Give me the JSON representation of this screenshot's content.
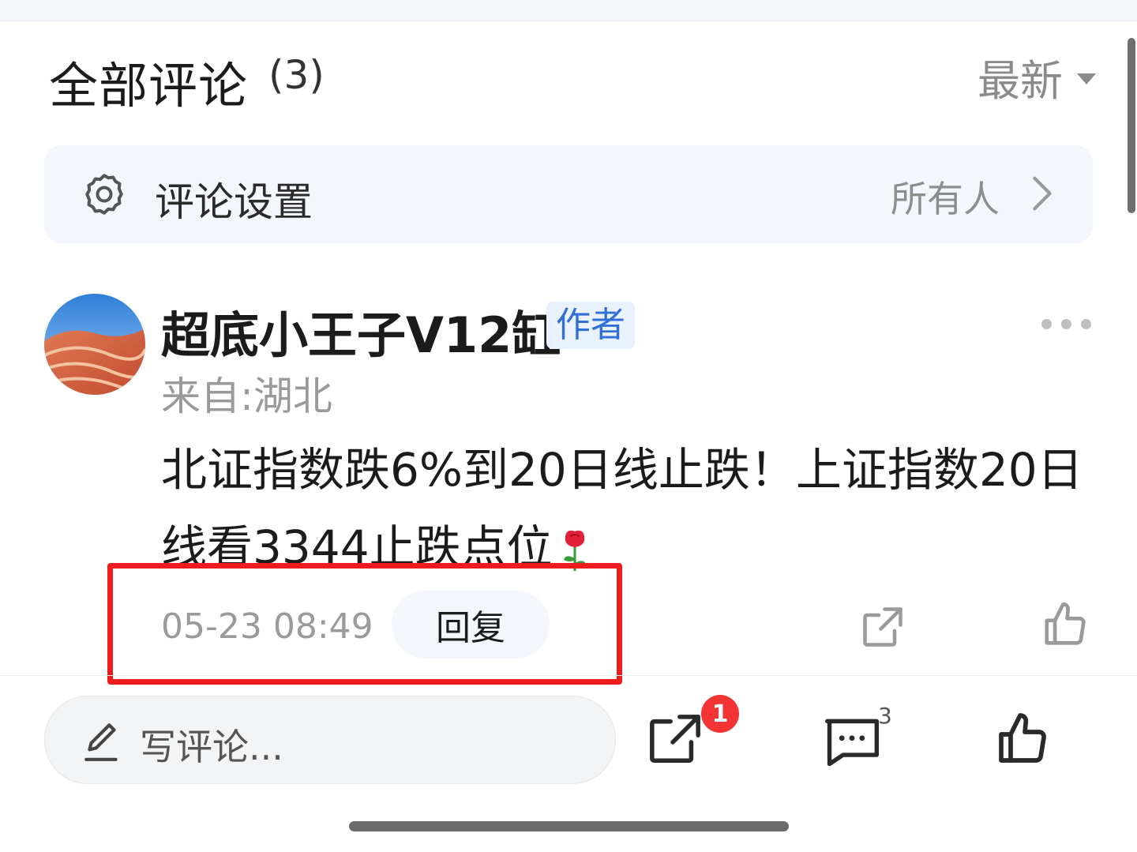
{
  "header": {
    "title": "全部评论",
    "count": "(3)",
    "sort_label": "最新"
  },
  "settings": {
    "label": "评论设置",
    "value": "所有人"
  },
  "comment": {
    "username": "超底小王子V12缸",
    "badge": "作者",
    "location": "来自:湖北",
    "text": "北证指数跌6%到20日线止跌！上证指数20日线看3344止跌点位",
    "emoji_icon": "rose-icon",
    "time": "05-23 08:49",
    "reply_label": "回复"
  },
  "bottom_bar": {
    "input_placeholder": "写评论...",
    "share_badge": "1",
    "comment_count": "3"
  },
  "colors": {
    "highlight": "#ee1c1c",
    "badge_bg": "#e9f1fd",
    "badge_text": "#2f6fd6",
    "notification": "#f23434"
  }
}
